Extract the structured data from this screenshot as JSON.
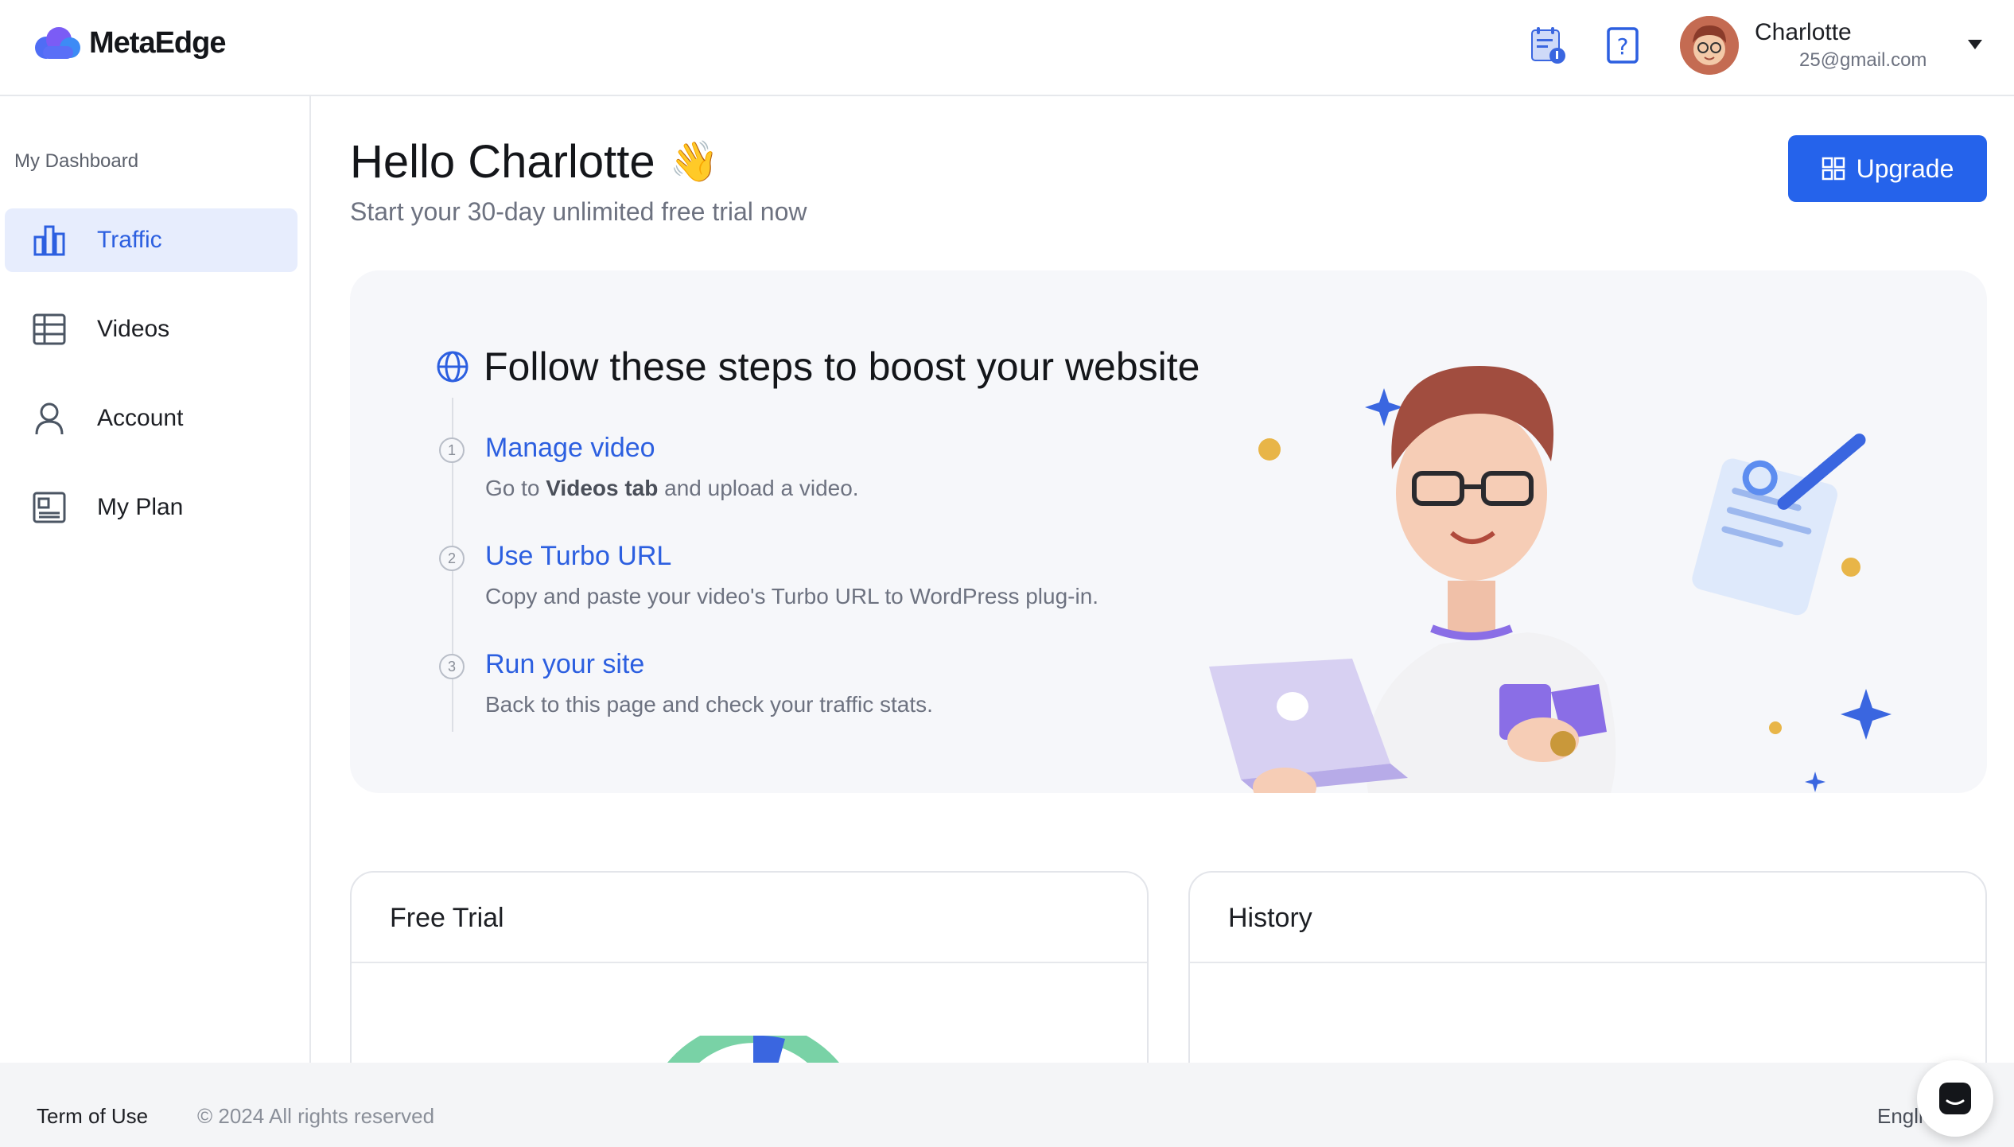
{
  "app": {
    "name": "MetaEdge"
  },
  "header": {
    "user_name": "Charlotte",
    "user_email": "25@gmail.com"
  },
  "sidebar": {
    "caption": "My Dashboard",
    "items": [
      {
        "label": "Traffic",
        "icon": "bar-chart-icon",
        "active": true
      },
      {
        "label": "Videos",
        "icon": "table-icon",
        "active": false
      },
      {
        "label": "Account",
        "icon": "user-icon",
        "active": false
      },
      {
        "label": "My Plan",
        "icon": "document-icon",
        "active": false
      }
    ]
  },
  "main": {
    "greeting": "Hello Charlotte",
    "greeting_emoji": "👋",
    "subtitle": "Start your 30-day unlimited free trial now",
    "upgrade_label": "Upgrade",
    "steps_title": "Follow these steps to boost your website",
    "steps": [
      {
        "num": "1",
        "title": "Manage video",
        "desc_pre": "Go to ",
        "desc_bold": "Videos tab",
        "desc_post": " and upload a video."
      },
      {
        "num": "2",
        "title": "Use Turbo URL",
        "desc": "Copy and paste your video's Turbo URL to WordPress plug-in."
      },
      {
        "num": "3",
        "title": "Run your site",
        "desc": "Back to this page and check your traffic stats."
      }
    ],
    "panels": {
      "free_trial": "Free Trial",
      "history": "History"
    }
  },
  "footer": {
    "terms": "Term of Use",
    "copyright": "© 2024 All rights reserved",
    "language": "Engli"
  },
  "colors": {
    "accent": "#2563eb",
    "active_bg": "#e7edfd",
    "card_bg": "#f6f7fa"
  }
}
